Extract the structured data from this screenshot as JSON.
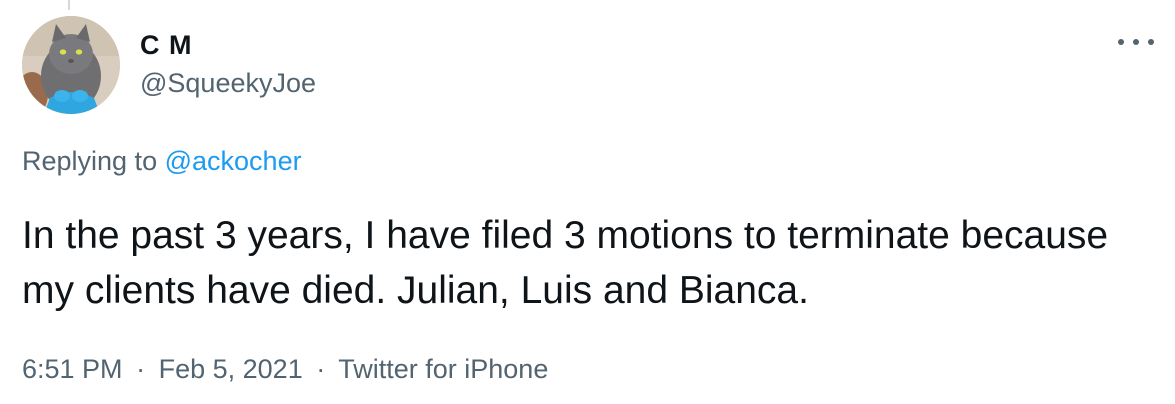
{
  "tweet": {
    "author": {
      "display_name": "C M",
      "handle": "@SqueekyJoe",
      "avatar": "cat-photo"
    },
    "reply_prefix": "Replying to",
    "reply_to": "@ackocher",
    "text": "In the past 3 years, I have filed 3 motions to terminate because my clients have died. Julian, Luis and Bianca.",
    "time": "6:51 PM",
    "date": "Feb 5, 2021",
    "separator": "·",
    "source": "Twitter for iPhone",
    "more_icon": "more-horizontal-icon"
  },
  "colors": {
    "text_primary": "#0f1419",
    "text_secondary": "#536471",
    "link": "#1d9bf0"
  }
}
